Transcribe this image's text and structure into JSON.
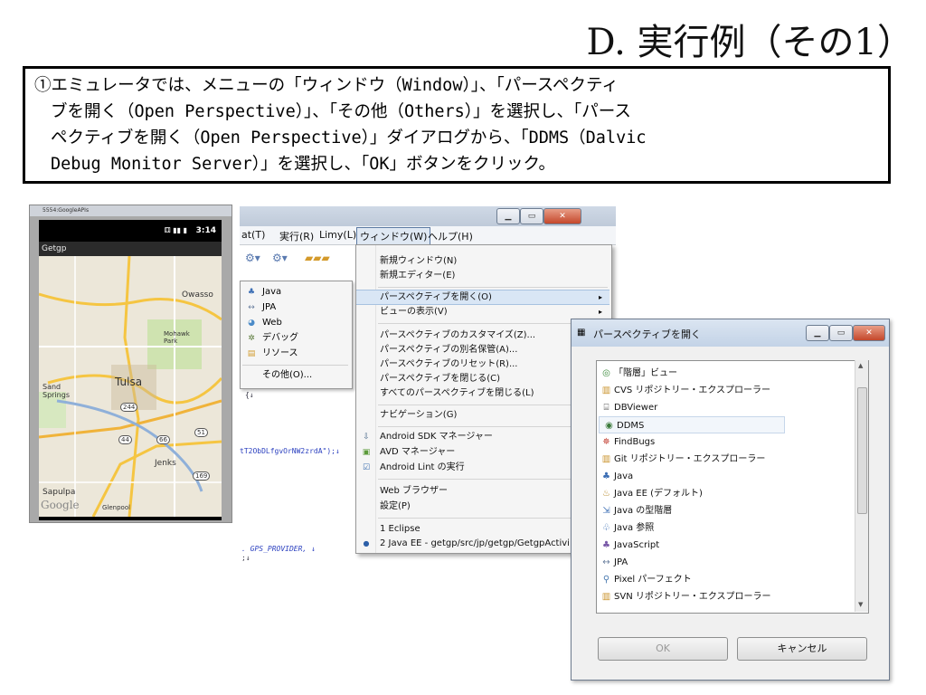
{
  "slide": {
    "title": "D. 実行例（その1）",
    "instruction_lines": [
      "①エミュレータでは、メニューの「ウィンドウ（Window）」、「パースペクティ",
      "ブを開く（Open Perspective）」、「その他（Others）」を選択し、「パース",
      "ペクティブを開く（Open Perspective）」ダイアログから、「DDMS（Dalvic",
      "Debug Monitor Server）」を選択し、「OK」ボタンをクリック。"
    ]
  },
  "emulator": {
    "window_title": "5554:GoogleAPIs",
    "status_time": "3:14",
    "app_title": "Getgp",
    "map_labels": [
      "Owasso",
      "Mohawk Park",
      "Sand Springs",
      "Tulsa",
      "Jenks",
      "Sapulpa",
      "Glenpool"
    ],
    "map_shields": [
      "244",
      "44",
      "66",
      "51",
      "169"
    ],
    "map_logo": "Google"
  },
  "eclipse": {
    "menubar": [
      "at(T)",
      "実行(R)",
      "Limy(L)",
      "ウィンドウ(W)",
      "ヘルプ(H)"
    ],
    "code_lines": [
      "{↓",
      "tT2ObDLfgvOrNW2zrdA\");↓",
      ". GPS_PROVIDER, ↓",
      ";↓"
    ],
    "perspective_submenu": [
      {
        "icon": "java-perspective-icon",
        "label": "Java"
      },
      {
        "icon": "jpa-icon",
        "label": "JPA"
      },
      {
        "icon": "web-icon",
        "label": "Web"
      },
      {
        "icon": "debug-icon",
        "label": "デバッグ"
      },
      {
        "icon": "resource-icon",
        "label": "リソース"
      },
      {
        "icon": "",
        "label": "その他(O)..."
      }
    ],
    "window_menu": {
      "groups": [
        [
          {
            "label": "新規ウィンドウ(N)"
          },
          {
            "label": "新規エディター(E)"
          }
        ],
        [
          {
            "label": "パースペクティブを開く(O)",
            "arrow": "▸",
            "highlighted": true
          },
          {
            "label": "ビューの表示(V)",
            "arrow": "▸"
          }
        ],
        [
          {
            "label": "パースペクティブのカスタマイズ(Z)..."
          },
          {
            "label": "パースペクティブの別名保管(A)..."
          },
          {
            "label": "パースペクティブのリセット(R)..."
          },
          {
            "label": "パースペクティブを閉じる(C)"
          },
          {
            "label": "すべてのパースペクティブを閉じる(L)"
          }
        ],
        [
          {
            "label": "ナビゲーション(G)",
            "arrow": "▸"
          }
        ],
        [
          {
            "label": "Android SDK マネージャー",
            "icon": "sdk-manager-icon"
          },
          {
            "label": "AVD マネージャー",
            "icon": "avd-manager-icon"
          },
          {
            "label": "Android Lint の実行",
            "icon": "lint-icon"
          }
        ],
        [
          {
            "label": "Web ブラウザー",
            "arrow": "▸"
          },
          {
            "label": "設定(P)"
          }
        ],
        [
          {
            "label": "1 Eclipse"
          },
          {
            "label": "2 Java EE - getgp/src/jp/getgp/GetgpActivi...",
            "icon": "radio-selected-icon"
          }
        ]
      ]
    }
  },
  "dialog": {
    "title": "パースペクティブを開く",
    "items": [
      {
        "icon": "hierarchy-view-icon",
        "label": "「階層」ビュー"
      },
      {
        "icon": "cvs-repository-icon",
        "label": "CVS リポジトリー・エクスプローラー"
      },
      {
        "icon": "database-icon",
        "label": "DBViewer"
      },
      {
        "icon": "ddms-icon",
        "label": "DDMS",
        "selected": true
      },
      {
        "icon": "findbugs-icon",
        "label": "FindBugs"
      },
      {
        "icon": "git-repository-icon",
        "label": "Git リポジトリー・エクスプローラー"
      },
      {
        "icon": "java-perspective-icon",
        "label": "Java"
      },
      {
        "icon": "java-ee-icon",
        "label": "Java EE (デフォルト)"
      },
      {
        "icon": "java-type-hierarchy-icon",
        "label": "Java の型階層"
      },
      {
        "icon": "java-browsing-icon",
        "label": "Java 参照"
      },
      {
        "icon": "javascript-icon",
        "label": "JavaScript"
      },
      {
        "icon": "jpa-icon",
        "label": "JPA"
      },
      {
        "icon": "pixel-perfect-icon",
        "label": "Pixel パーフェクト"
      },
      {
        "icon": "svn-repository-icon",
        "label": "SVN リポジトリー・エクスプローラー"
      }
    ],
    "ok_label": "OK",
    "cancel_label": "キャンセル"
  }
}
